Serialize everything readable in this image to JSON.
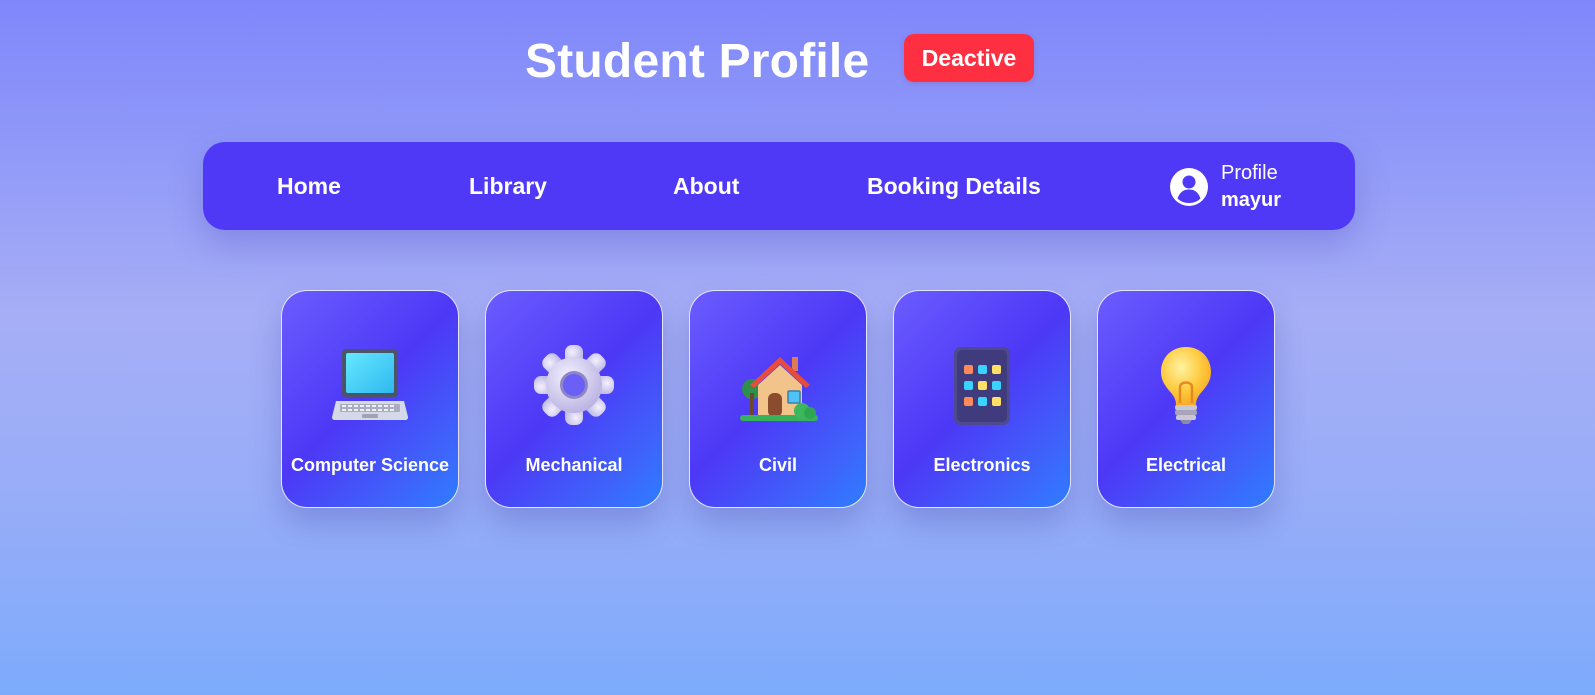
{
  "header": {
    "title": "Student Profile",
    "status_badge": "Deactive"
  },
  "nav": {
    "items": [
      {
        "label": "Home"
      },
      {
        "label": "Library"
      },
      {
        "label": "About"
      },
      {
        "label": "Booking Details"
      }
    ],
    "profile": {
      "label": "Profile",
      "username": "mayur",
      "icon": "user-circle-icon"
    }
  },
  "departments": [
    {
      "label": "Computer Science",
      "icon": "laptop-icon"
    },
    {
      "label": "Mechanical",
      "icon": "gear-icon"
    },
    {
      "label": "Civil",
      "icon": "house-icon"
    },
    {
      "label": "Electronics",
      "icon": "device-keypad-icon"
    },
    {
      "label": "Electrical",
      "icon": "lightbulb-icon"
    }
  ],
  "colors": {
    "nav_background": "#4f39f7",
    "status_badge": "#ff2f42",
    "card_gradient_start": "#6b5cff",
    "card_gradient_end": "#2f7dff"
  }
}
